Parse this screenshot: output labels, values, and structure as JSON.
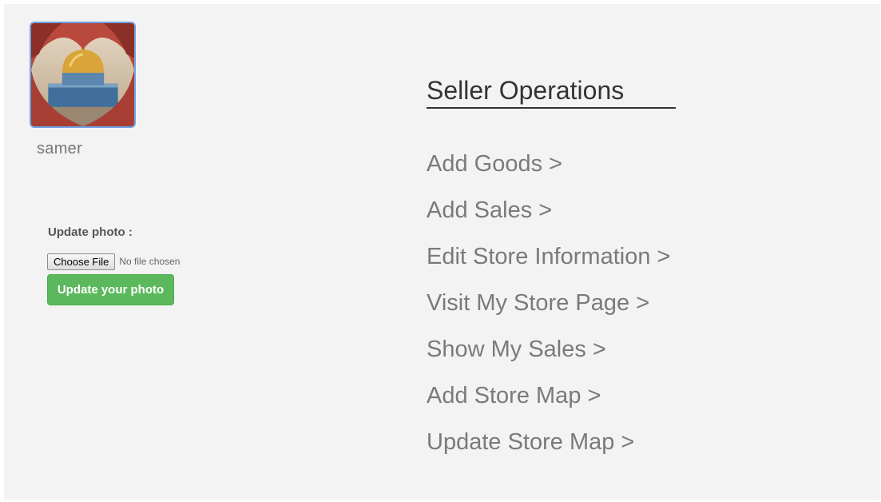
{
  "profile": {
    "username": "samer",
    "avatar_icon": "dome-of-the-rock-heart-photo"
  },
  "photo_upload": {
    "label": "Update photo :",
    "choose_file_label": "Choose File",
    "no_file_text": "No file chosen",
    "submit_label": "Update your photo"
  },
  "operations": {
    "title": "Seller Operations",
    "items": [
      {
        "label": "Add Goods >"
      },
      {
        "label": "Add Sales >"
      },
      {
        "label": "Edit Store Information >"
      },
      {
        "label": "Visit My Store Page >"
      },
      {
        "label": "Show My Sales >"
      },
      {
        "label": "Add Store Map >"
      },
      {
        "label": "Update Store Map >"
      }
    ]
  },
  "colors": {
    "panel_bg": "#f3f3f3",
    "button_green": "#5cb85c",
    "avatar_border": "#6ea1e6",
    "link_gray": "#7a7a7a"
  }
}
